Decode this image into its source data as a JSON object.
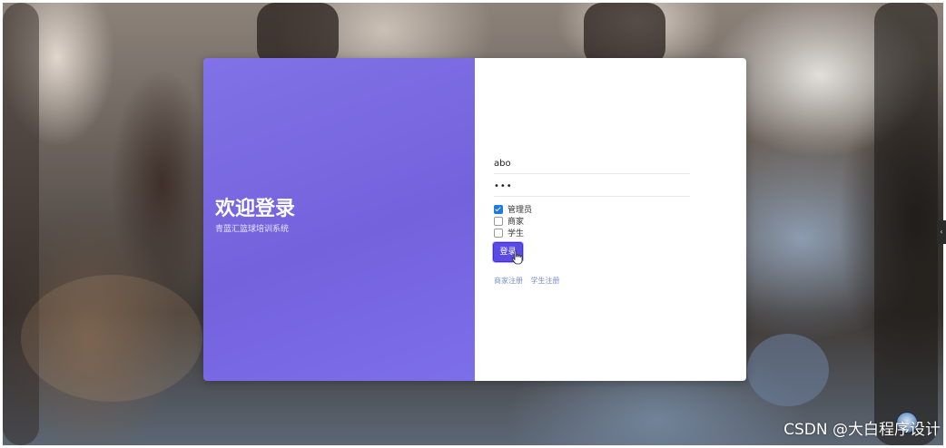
{
  "login": {
    "title": "欢迎登录",
    "subtitle": "青蓝汇篮球培训系统",
    "username_value": "abo",
    "password_value": "•••",
    "roles": [
      {
        "label": "管理员",
        "checked": true
      },
      {
        "label": "商家",
        "checked": false
      },
      {
        "label": "学生",
        "checked": false
      }
    ],
    "submit_label": "登录",
    "links": {
      "merchant_register": "商家注册",
      "student_register": "学生注册"
    }
  },
  "side_tab": {
    "icon": "chevron-left-icon",
    "glyph": "‹"
  },
  "watermark": {
    "text": "CSDN @大白程序设计"
  },
  "colors": {
    "panel_accent": "#7462dc",
    "button": "#5a4be6",
    "checkbox": "#1f7ae0",
    "link": "#7b8fd0"
  }
}
